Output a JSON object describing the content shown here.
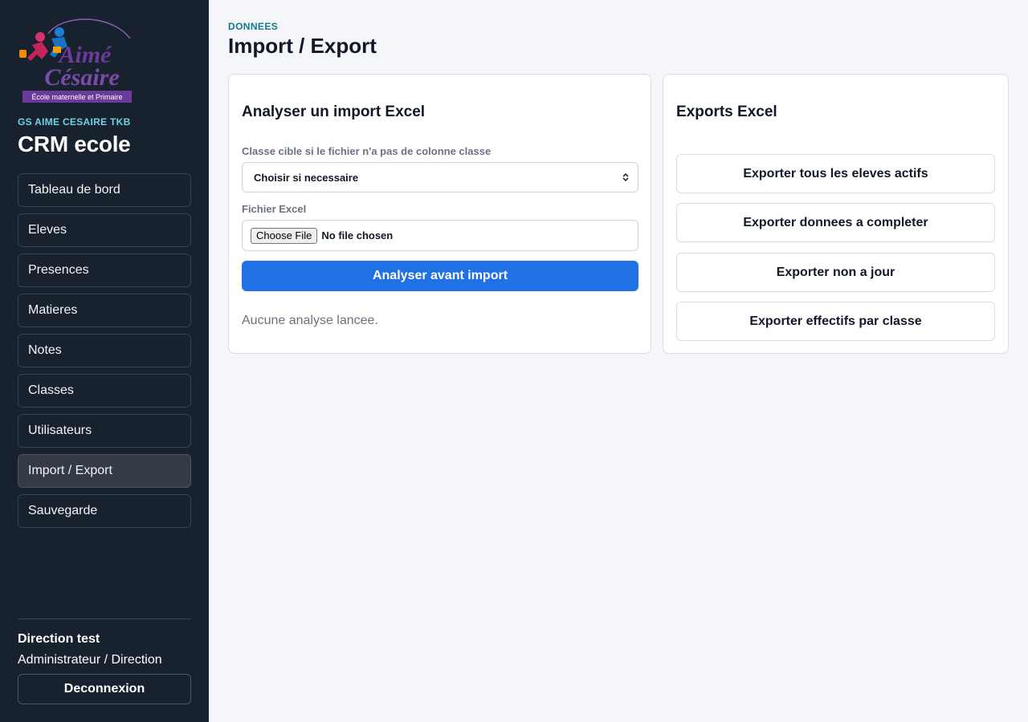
{
  "sidebar": {
    "logo": {
      "line1": "Aimé",
      "line2": "Césaire",
      "tagline": "École maternelle et Primaire"
    },
    "school_name": "GS AIME CESAIRE TKB",
    "app_title": "CRM ecole",
    "nav": [
      {
        "label": "Tableau de bord",
        "active": false
      },
      {
        "label": "Eleves",
        "active": false
      },
      {
        "label": "Presences",
        "active": false
      },
      {
        "label": "Matieres",
        "active": false
      },
      {
        "label": "Notes",
        "active": false
      },
      {
        "label": "Classes",
        "active": false
      },
      {
        "label": "Utilisateurs",
        "active": false
      },
      {
        "label": "Import / Export",
        "active": true
      },
      {
        "label": "Sauvegarde",
        "active": false
      }
    ],
    "user": {
      "name": "Direction test",
      "role": "Administrateur / Direction"
    },
    "logout_label": "Deconnexion"
  },
  "header": {
    "eyebrow": "DONNEES",
    "title": "Import / Export"
  },
  "import_card": {
    "title": "Analyser un import Excel",
    "class_label": "Classe cible si le fichier n'a pas de colonne classe",
    "class_select_value": "Choisir si necessaire",
    "file_label": "Fichier Excel",
    "file_button": "Choose File",
    "file_status": "No file chosen",
    "analyze_button": "Analyser avant import",
    "empty_state": "Aucune analyse lancee."
  },
  "export_card": {
    "title": "Exports Excel",
    "buttons": [
      "Exporter tous les eleves actifs",
      "Exporter donnees a completer",
      "Exporter non a jour",
      "Exporter effectifs par classe"
    ]
  },
  "colors": {
    "sidebar_bg": "#18212e",
    "accent_teal": "#0f7a8a",
    "primary_blue": "#2070e6",
    "logo_purple": "#6b3a9a"
  }
}
